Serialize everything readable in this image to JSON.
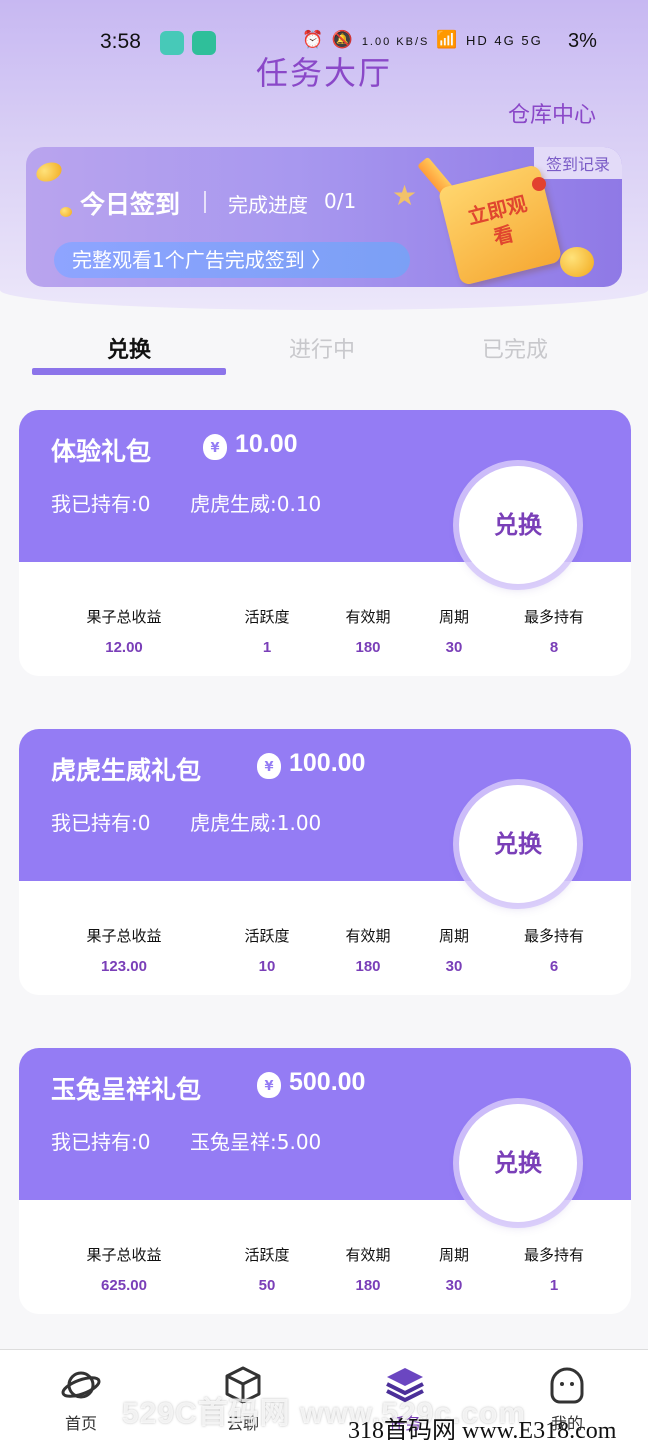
{
  "status_bar": {
    "time": "3:58",
    "net_speed": "1.00 KB/S",
    "signal_labels": "HD 4G 5G",
    "battery": "3%"
  },
  "header": {
    "title": "任务大厅",
    "warehouse_link": "仓库中心"
  },
  "signin": {
    "record_label": "签到记录",
    "title": "今日签到",
    "progress_label": "完成进度",
    "progress_value": "0/1",
    "task_text": "完整观看1个广告完成签到 〉",
    "watch_badge": "立即观看"
  },
  "tabs": [
    {
      "label": "兑换",
      "active": true
    },
    {
      "label": "进行中",
      "active": false
    },
    {
      "label": "已完成",
      "active": false
    }
  ],
  "packages": [
    {
      "name": "体验礼包",
      "price": "10.00",
      "held": "我已持有:0",
      "yield": "虎虎生威:0.10",
      "button": "兑换",
      "stats": [
        {
          "label": "果子总收益",
          "value": "12.00"
        },
        {
          "label": "活跃度",
          "value": "1"
        },
        {
          "label": "有效期",
          "value": "180"
        },
        {
          "label": "周期",
          "value": "30"
        },
        {
          "label": "最多持有",
          "value": "8"
        }
      ]
    },
    {
      "name": "虎虎生威礼包",
      "price": "100.00",
      "held": "我已持有:0",
      "yield": "虎虎生威:1.00",
      "button": "兑换",
      "stats": [
        {
          "label": "果子总收益",
          "value": "123.00"
        },
        {
          "label": "活跃度",
          "value": "10"
        },
        {
          "label": "有效期",
          "value": "180"
        },
        {
          "label": "周期",
          "value": "30"
        },
        {
          "label": "最多持有",
          "value": "6"
        }
      ]
    },
    {
      "name": "玉兔呈祥礼包",
      "price": "500.00",
      "held": "我已持有:0",
      "yield": "玉兔呈祥:5.00",
      "button": "兑换",
      "stats": [
        {
          "label": "果子总收益",
          "value": "625.00"
        },
        {
          "label": "活跃度",
          "value": "50"
        },
        {
          "label": "有效期",
          "value": "180"
        },
        {
          "label": "周期",
          "value": "30"
        },
        {
          "label": "最多持有",
          "value": "1"
        }
      ]
    }
  ],
  "bottom_nav": [
    {
      "label": "首页",
      "icon": "planet-icon"
    },
    {
      "label": "云聊",
      "icon": "cube-icon"
    },
    {
      "label": "任务",
      "icon": "layers-icon",
      "active": true
    },
    {
      "label": "我的",
      "icon": "face-icon"
    }
  ],
  "watermarks": {
    "line1": "529C首码网 www.529c.com",
    "line2": "318首码网 www.E318.com"
  },
  "colors": {
    "accent": "#947cf4",
    "brand_text": "#7a3fb8",
    "title": "#8a48c8"
  }
}
